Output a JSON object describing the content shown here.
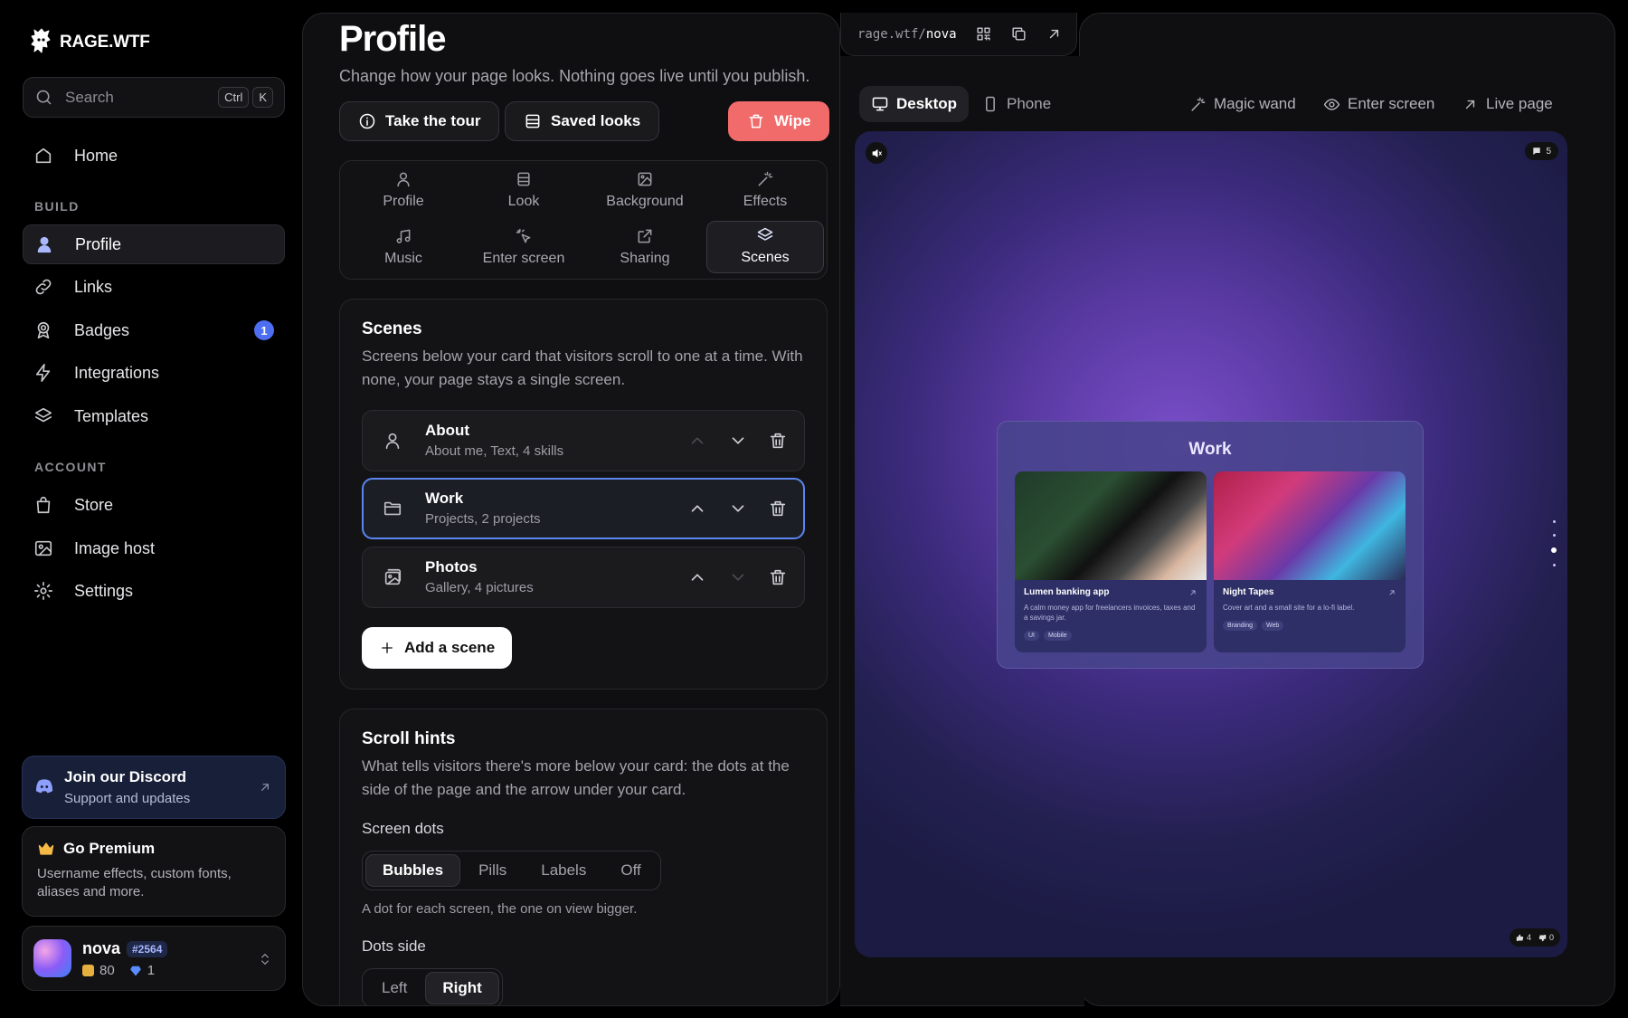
{
  "brand": {
    "name": "RAGE.WTF"
  },
  "search": {
    "placeholder": "Search",
    "key1": "Ctrl",
    "key2": "K"
  },
  "nav": {
    "home": "Home",
    "build_label": "BUILD",
    "build": [
      {
        "label": "Profile",
        "icon": "user-icon"
      },
      {
        "label": "Links",
        "icon": "link-icon"
      },
      {
        "label": "Badges",
        "icon": "badge-icon",
        "count": "1"
      },
      {
        "label": "Integrations",
        "icon": "bolt-icon"
      },
      {
        "label": "Templates",
        "icon": "layers-icon"
      }
    ],
    "account_label": "ACCOUNT",
    "account": [
      {
        "label": "Store",
        "icon": "bag-icon"
      },
      {
        "label": "Image host",
        "icon": "image-icon"
      },
      {
        "label": "Settings",
        "icon": "gear-icon"
      }
    ]
  },
  "discord": {
    "title": "Join our Discord",
    "subtitle": "Support and updates"
  },
  "premium": {
    "title": "Go Premium",
    "subtitle": "Username effects, custom fonts, aliases and more."
  },
  "user": {
    "name": "nova",
    "tag": "#2564",
    "coins": "80",
    "gems": "1"
  },
  "editor": {
    "title": "Profile",
    "subtitle": "Change how your page looks. Nothing goes live until you publish.",
    "tour_label": "Take the tour",
    "saved_label": "Saved looks",
    "wipe_label": "Wipe",
    "tabs": [
      "Profile",
      "Look",
      "Background",
      "Effects",
      "Music",
      "Enter screen",
      "Sharing",
      "Scenes"
    ],
    "active_tab": "Scenes",
    "scenes": {
      "title": "Scenes",
      "description": "Screens below your card that visitors scroll to one at a time. With none, your page stays a single screen.",
      "items": [
        {
          "title": "About",
          "subtitle": "About me, Text, 4 skills"
        },
        {
          "title": "Work",
          "subtitle": "Projects, 2 projects"
        },
        {
          "title": "Photos",
          "subtitle": "Gallery, 4 pictures"
        }
      ],
      "add_label": "Add a scene"
    },
    "scroll_hints": {
      "title": "Scroll hints",
      "description": "What tells visitors there's more below your card: the dots at the side of the page and the arrow under your card.",
      "dots_label": "Screen dots",
      "dots_options": [
        "Bubbles",
        "Pills",
        "Labels",
        "Off"
      ],
      "dots_selected": "Bubbles",
      "dots_help": "A dot for each screen, the one on view bigger.",
      "side_label": "Dots side",
      "side_options": [
        "Left",
        "Right"
      ],
      "side_selected": "Right"
    }
  },
  "preview": {
    "url_prefix": "rage.wtf/",
    "url_user": "nova",
    "desktop_label": "Desktop",
    "phone_label": "Phone",
    "magic_label": "Magic wand",
    "enter_label": "Enter screen",
    "live_label": "Live page",
    "comments": "5",
    "likes": "4",
    "dislikes": "0",
    "work_title": "Work",
    "projects": [
      {
        "title": "Lumen banking app",
        "desc": "A calm money app for freelancers invoices, taxes and a savings jar.",
        "tags": [
          "UI",
          "Mobile"
        ]
      },
      {
        "title": "Night Tapes",
        "desc": "Cover art and a small site for a lo-fi label.",
        "tags": [
          "Branding",
          "Web"
        ]
      }
    ]
  },
  "colors": {
    "accent": "#5b86f0",
    "wipe": "#f26b6b",
    "badge": "#4e6ef2"
  }
}
